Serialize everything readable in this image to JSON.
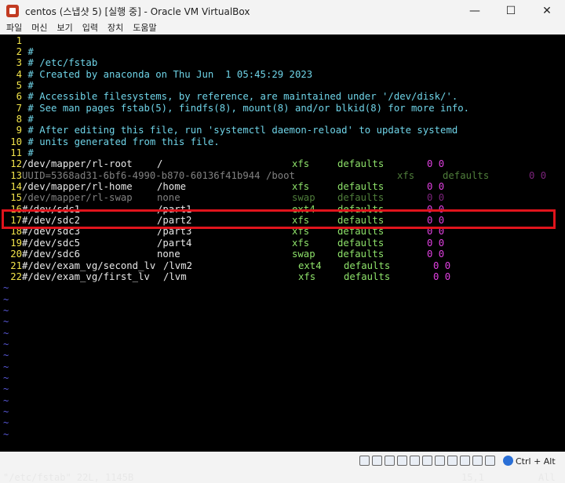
{
  "window": {
    "title": "centos (스냅샷 5) [실행 중] - Oracle VM VirtualBox",
    "minimize": "—",
    "maximize": "☐",
    "close": "✕"
  },
  "menu": [
    "파일",
    "머신",
    "보기",
    "입력",
    "장치",
    "도움말"
  ],
  "terminal": {
    "lines": [
      {
        "n": "1",
        "text": ""
      },
      {
        "n": "2",
        "text": "#"
      },
      {
        "n": "3",
        "text": "# /etc/fstab"
      },
      {
        "n": "4",
        "text": "# Created by anaconda on Thu Jun  1 05:45:29 2023"
      },
      {
        "n": "5",
        "text": "#"
      },
      {
        "n": "6",
        "text": "# Accessible filesystems, by reference, are maintained under '/dev/disk/'."
      },
      {
        "n": "7",
        "text": "# See man pages fstab(5), findfs(8), mount(8) and/or blkid(8) for more info."
      },
      {
        "n": "8",
        "text": "#"
      },
      {
        "n": "9",
        "text": "# After editing this file, run 'systemctl daemon-reload' to update systemd"
      },
      {
        "n": "10",
        "text": "# units generated from this file."
      },
      {
        "n": "11",
        "text": "#"
      }
    ],
    "entries": [
      {
        "n": "12",
        "dev": "/dev/mapper/rl-root",
        "mnt": "/",
        "fs": "xfs",
        "opt": "defaults",
        "dmp": "0 0"
      },
      {
        "n": "13",
        "dev": "UUID=5368ad31-6bf6-4990-b870-60136f41b944 /boot",
        "mnt": "",
        "fs": "xfs",
        "opt": "defaults",
        "dmp": "0 0"
      },
      {
        "n": "14",
        "dev": "/dev/mapper/rl-home",
        "mnt": "/home",
        "fs": "xfs",
        "opt": "defaults",
        "dmp": "0 0"
      },
      {
        "n": "15",
        "dev": "/dev/mapper/rl-swap",
        "mnt": "none",
        "fs": "swap",
        "opt": "defaults",
        "dmp": "0 0"
      },
      {
        "n": "16",
        "dev": "#/dev/sdc1",
        "mnt": "/part1",
        "fs": "ext4",
        "opt": "defaults",
        "dmp": "0 0"
      },
      {
        "n": "17",
        "dev": "#/dev/sdc2",
        "mnt": "/part2",
        "fs": "xfs",
        "opt": "defaults",
        "dmp": "0 0"
      },
      {
        "n": "18",
        "dev": "#/dev/sdc3",
        "mnt": "/part3",
        "fs": "xfs",
        "opt": "defaults",
        "dmp": "0 0"
      },
      {
        "n": "19",
        "dev": "#/dev/sdc5",
        "mnt": "/part4",
        "fs": "xfs",
        "opt": "defaults",
        "dmp": "0 0"
      },
      {
        "n": "20",
        "dev": "#/dev/sdc6",
        "mnt": "none",
        "fs": "swap",
        "opt": "defaults",
        "dmp": "0 0"
      },
      {
        "n": "21",
        "dev": "#/dev/exam_vg/second_lv",
        "mnt": "/lvm2",
        "fs": "ext4",
        "opt": "defaults",
        "dmp": "0 0"
      },
      {
        "n": "22",
        "dev": "#/dev/exam_vg/first_lv",
        "mnt": "/lvm",
        "fs": "xfs",
        "opt": "defaults",
        "dmp": "0 0"
      }
    ],
    "tilde": "~",
    "status_file": "\"/etc/fstab\" 22L, 1145B",
    "status_pos": "15,1",
    "status_all": "All"
  },
  "statusbar": {
    "hostkey": "Ctrl + Alt"
  },
  "colors": {
    "line_number": "#f2e44a",
    "comment": "#6fd4e8",
    "fs_type": "#8ee26a",
    "dump_pass": "#e040e0",
    "tilde": "#5959d9",
    "highlight": "#e0141c"
  }
}
